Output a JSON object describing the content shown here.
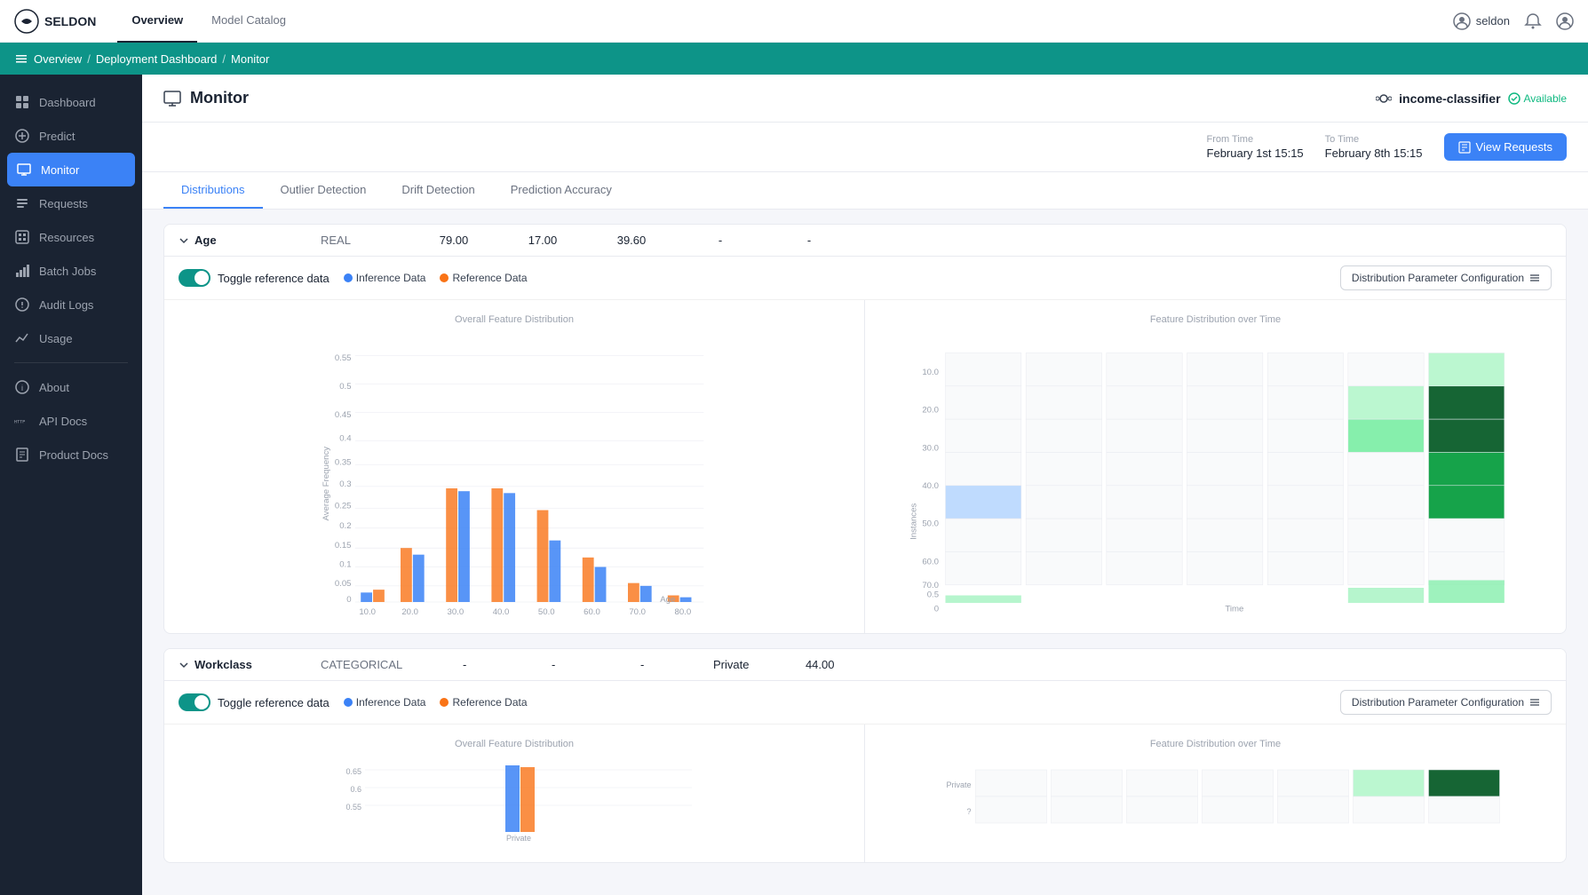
{
  "app": {
    "logo": "SELDON",
    "nav_tabs": [
      {
        "label": "Overview",
        "active": true
      },
      {
        "label": "Model Catalog",
        "active": false
      }
    ],
    "user": "seldon"
  },
  "breadcrumb": {
    "items": [
      "Overview",
      "Deployment Dashboard",
      "Monitor"
    ]
  },
  "sidebar": {
    "items": [
      {
        "id": "dashboard",
        "label": "Dashboard",
        "icon": "grid"
      },
      {
        "id": "predict",
        "label": "Predict",
        "icon": "plus"
      },
      {
        "id": "monitor",
        "label": "Monitor",
        "icon": "monitor",
        "active": true
      },
      {
        "id": "requests",
        "label": "Requests",
        "icon": "list"
      },
      {
        "id": "resources",
        "label": "Resources",
        "icon": "cpu"
      },
      {
        "id": "batch-jobs",
        "label": "Batch Jobs",
        "icon": "bar-chart"
      },
      {
        "id": "audit-logs",
        "label": "Audit Logs",
        "icon": "clock"
      },
      {
        "id": "usage",
        "label": "Usage",
        "icon": "activity"
      },
      {
        "id": "about",
        "label": "About",
        "icon": "info"
      },
      {
        "id": "api-docs",
        "label": "API Docs",
        "icon": "http"
      },
      {
        "id": "product-docs",
        "label": "Product Docs",
        "icon": "book"
      }
    ]
  },
  "page": {
    "title": "Monitor",
    "model_name": "income-classifier",
    "available": "Available",
    "from_time_label": "From Time",
    "from_time": "February 1st 15:15",
    "to_time_label": "To Time",
    "to_time": "February 8th 15:15",
    "view_requests_btn": "View Requests"
  },
  "tabs": [
    {
      "label": "Distributions",
      "active": true
    },
    {
      "label": "Outlier Detection",
      "active": false
    },
    {
      "label": "Drift Detection",
      "active": false
    },
    {
      "label": "Prediction Accuracy",
      "active": false
    }
  ],
  "features": [
    {
      "name": "Age",
      "chevron": "down",
      "type": "REAL",
      "val1": "79.00",
      "val2": "17.00",
      "val3": "39.60",
      "val4": "-",
      "val5": "-",
      "toggle_label": "Toggle reference data",
      "inference_label": "Inference Data",
      "reference_label": "Reference Data",
      "config_btn": "Distribution Parameter Configuration",
      "chart1_title": "Overall Feature Distribution",
      "chart2_title": "Feature Distribution over Time"
    },
    {
      "name": "Workclass",
      "chevron": "down",
      "type": "CATEGORICAL",
      "val1": "-",
      "val2": "-",
      "val3": "-",
      "val4": "Private",
      "val5": "44.00",
      "toggle_label": "Toggle reference data",
      "inference_label": "Inference Data",
      "reference_label": "Reference Data",
      "config_btn": "Distribution Parameter Configuration",
      "chart1_title": "Overall Feature Distribution",
      "chart2_title": "Feature Distribution over Time"
    }
  ]
}
